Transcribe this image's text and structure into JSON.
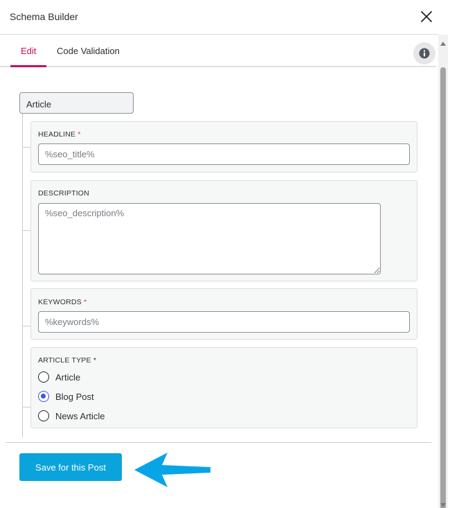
{
  "header": {
    "title": "Schema Builder"
  },
  "tabs": [
    {
      "label": "Edit",
      "active": true
    },
    {
      "label": "Code Validation",
      "active": false
    }
  ],
  "schema": {
    "type_label": "Article"
  },
  "fields": {
    "headline": {
      "label": "HEADLINE",
      "required_mark": "*",
      "placeholder": "%seo_title%"
    },
    "description": {
      "label": "DESCRIPTION",
      "placeholder": "%seo_description%"
    },
    "keywords": {
      "label": "KEYWORDS",
      "required_mark": "*",
      "placeholder": "%keywords%"
    },
    "article_type": {
      "label": "ARTICLE TYPE *",
      "options": [
        {
          "label": "Article",
          "checked": false
        },
        {
          "label": "Blog Post",
          "checked": true
        },
        {
          "label": "News Article",
          "checked": false
        }
      ]
    }
  },
  "footer": {
    "save_label": "Save for this Post"
  },
  "icons": {
    "close": "close-icon",
    "info": "info-icon",
    "arrow": "arrow-left-icon"
  },
  "colors": {
    "accent_pink": "#c4105a",
    "save_blue": "#0aa3dc",
    "arrow_blue": "#08a4e8",
    "radio_blue": "#3858e9"
  }
}
